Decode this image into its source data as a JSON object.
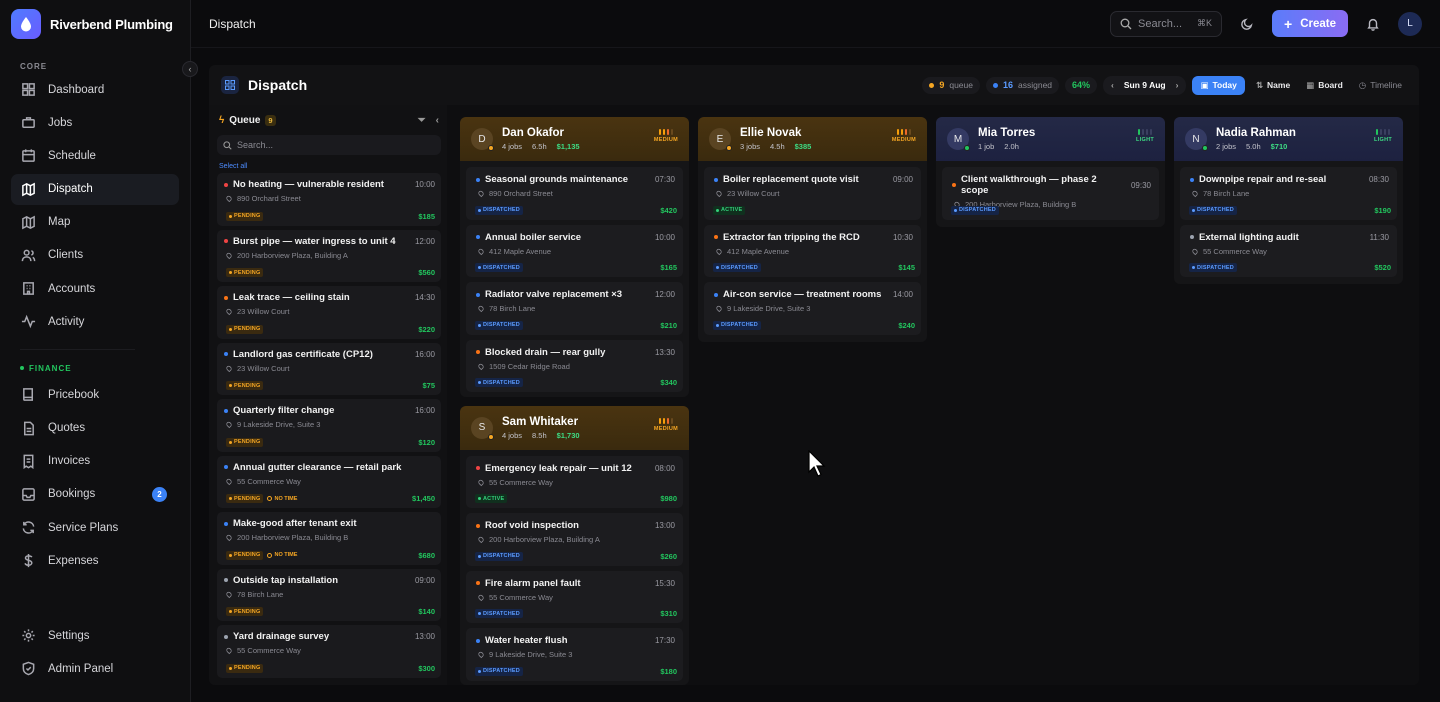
{
  "brand": {
    "name": "Riverbend Plumbing"
  },
  "sidebar": {
    "core_label": "CORE",
    "finance_label": "FINANCE",
    "core_items": [
      {
        "label": "Dashboard",
        "icon": "grid-icon"
      },
      {
        "label": "Jobs",
        "icon": "briefcase-icon"
      },
      {
        "label": "Schedule",
        "icon": "calendar-icon"
      },
      {
        "label": "Dispatch",
        "icon": "map-icon",
        "active": true
      },
      {
        "label": "Map",
        "icon": "map-icon"
      },
      {
        "label": "Clients",
        "icon": "users-icon"
      },
      {
        "label": "Accounts",
        "icon": "building-icon"
      },
      {
        "label": "Activity",
        "icon": "activity-icon"
      }
    ],
    "finance_items": [
      {
        "label": "Pricebook",
        "icon": "book-icon"
      },
      {
        "label": "Quotes",
        "icon": "document-icon"
      },
      {
        "label": "Invoices",
        "icon": "receipt-icon"
      },
      {
        "label": "Bookings",
        "icon": "inbox-icon",
        "badge": "2"
      },
      {
        "label": "Service Plans",
        "icon": "refresh-icon"
      },
      {
        "label": "Expenses",
        "icon": "dollar-icon"
      }
    ],
    "bottom_items": [
      {
        "label": "Settings",
        "icon": "gear-icon"
      },
      {
        "label": "Admin Panel",
        "icon": "shield-icon"
      }
    ]
  },
  "topbar": {
    "title": "Dispatch",
    "search_label": "Search...",
    "shortcut": "⌘K",
    "create_label": "Create",
    "user_initial": "L"
  },
  "dispatch": {
    "title": "Dispatch",
    "queue_count": "9",
    "queue_label": "queue",
    "assigned_count": "16",
    "assigned_label": "assigned",
    "utilization": "64%",
    "date": "Sun 9 Aug",
    "today_label": "Today",
    "sort_label": "Name",
    "board_label": "Board",
    "timeline_label": "Timeline"
  },
  "queue": {
    "title": "Queue",
    "count": "9",
    "search_placeholder": "Search...",
    "select_all": "Select all",
    "jobs": [
      {
        "title": "No heating — vulnerable resident",
        "time": "10:00",
        "address": "890 Orchard Street",
        "status": "PENDING",
        "price": "$185",
        "priority": "#ef4444",
        "no_time": ""
      },
      {
        "title": "Burst pipe — water ingress to unit 4",
        "time": "12:00",
        "address": "200 Harborview Plaza, Building A",
        "status": "PENDING",
        "price": "$560",
        "priority": "#ef4444",
        "no_time": ""
      },
      {
        "title": "Leak trace — ceiling stain",
        "time": "14:30",
        "address": "23 Willow Court",
        "status": "PENDING",
        "price": "$220",
        "priority": "#f97316",
        "no_time": ""
      },
      {
        "title": "Landlord gas certificate (CP12)",
        "time": "16:00",
        "address": "23 Willow Court",
        "status": "PENDING",
        "price": "$75",
        "priority": "#3b82f6",
        "no_time": ""
      },
      {
        "title": "Quarterly filter change",
        "time": "16:00",
        "address": "9 Lakeside Drive, Suite 3",
        "status": "PENDING",
        "price": "$120",
        "priority": "#3b82f6",
        "no_time": ""
      },
      {
        "title": "Annual gutter clearance — retail park",
        "time": "",
        "address": "55 Commerce Way",
        "status": "PENDING",
        "price": "$1,450",
        "priority": "#3b82f6",
        "no_time": "NO TIME"
      },
      {
        "title": "Make-good after tenant exit",
        "time": "",
        "address": "200 Harborview Plaza, Building B",
        "status": "PENDING",
        "price": "$680",
        "priority": "#3b82f6",
        "no_time": "NO TIME"
      },
      {
        "title": "Outside tap installation",
        "time": "09:00",
        "address": "78 Birch Lane",
        "status": "PENDING",
        "price": "$140",
        "priority": "#9ca3af",
        "no_time": ""
      },
      {
        "title": "Yard drainage survey",
        "time": "13:00",
        "address": "55 Commerce Way",
        "status": "PENDING",
        "price": "$300",
        "priority": "#9ca3af",
        "no_time": ""
      }
    ]
  },
  "technicians": [
    {
      "name": "Dan Okafor",
      "initial": "D",
      "jobs": "4 jobs",
      "hours": "6.5h",
      "revenue": "$1,135",
      "load": "MEDIUM",
      "status_color": "#f5a623",
      "jobs_list": [
        {
          "title": "Seasonal grounds maintenance",
          "time": "07:30",
          "address": "890 Orchard Street",
          "status": "DISPATCHED",
          "price": "$420",
          "priority": "#3b82f6"
        },
        {
          "title": "Annual boiler service",
          "time": "10:00",
          "address": "412 Maple Avenue",
          "status": "DISPATCHED",
          "price": "$165",
          "priority": "#3b82f6"
        },
        {
          "title": "Radiator valve replacement ×3",
          "time": "12:00",
          "address": "78 Birch Lane",
          "status": "DISPATCHED",
          "price": "$210",
          "priority": "#3b82f6"
        },
        {
          "title": "Blocked drain — rear gully",
          "time": "13:30",
          "address": "1509 Cedar Ridge Road",
          "status": "DISPATCHED",
          "price": "$340",
          "priority": "#f97316"
        }
      ]
    },
    {
      "name": "Ellie Novak",
      "initial": "E",
      "jobs": "3 jobs",
      "hours": "4.5h",
      "revenue": "$385",
      "load": "MEDIUM",
      "status_color": "#f5a623",
      "jobs_list": [
        {
          "title": "Boiler replacement quote visit",
          "time": "09:00",
          "address": "23 Willow Court",
          "status": "ACTIVE",
          "price": "",
          "priority": "#3b82f6"
        },
        {
          "title": "Extractor fan tripping the RCD",
          "time": "10:30",
          "address": "412 Maple Avenue",
          "status": "DISPATCHED",
          "price": "$145",
          "priority": "#f97316"
        },
        {
          "title": "Air-con service — treatment rooms",
          "time": "14:00",
          "address": "9 Lakeside Drive, Suite 3",
          "status": "DISPATCHED",
          "price": "$240",
          "priority": "#3b82f6"
        }
      ]
    },
    {
      "name": "Mia Torres",
      "initial": "M",
      "jobs": "1 job",
      "hours": "2.0h",
      "revenue": "",
      "load": "LIGHT",
      "status_color": "#22c55e",
      "jobs_list": [
        {
          "title": "Client walkthrough — phase 2 scope",
          "time": "09:30",
          "address": "200 Harborview Plaza, Building B",
          "status": "DISPATCHED",
          "price": "",
          "priority": "#f97316"
        }
      ]
    },
    {
      "name": "Nadia Rahman",
      "initial": "N",
      "jobs": "2 jobs",
      "hours": "5.0h",
      "revenue": "$710",
      "load": "LIGHT",
      "status_color": "#22c55e",
      "jobs_list": [
        {
          "title": "Downpipe repair and re-seal",
          "time": "08:30",
          "address": "78 Birch Lane",
          "status": "DISPATCHED",
          "price": "$190",
          "priority": "#3b82f6"
        },
        {
          "title": "External lighting audit",
          "time": "11:30",
          "address": "55 Commerce Way",
          "status": "DISPATCHED",
          "price": "$520",
          "priority": "#9ca3af"
        }
      ]
    },
    {
      "name": "Sam Whitaker",
      "initial": "S",
      "jobs": "4 jobs",
      "hours": "8.5h",
      "revenue": "$1,730",
      "load": "MEDIUM",
      "status_color": "#f5a623",
      "jobs_list": [
        {
          "title": "Emergency leak repair — unit 12",
          "time": "08:00",
          "address": "55 Commerce Way",
          "status": "ACTIVE",
          "price": "$980",
          "priority": "#ef4444"
        },
        {
          "title": "Roof void inspection",
          "time": "13:00",
          "address": "200 Harborview Plaza, Building A",
          "status": "DISPATCHED",
          "price": "$260",
          "priority": "#f97316"
        },
        {
          "title": "Fire alarm panel fault",
          "time": "15:30",
          "address": "55 Commerce Way",
          "status": "DISPATCHED",
          "price": "$310",
          "priority": "#f97316"
        },
        {
          "title": "Water heater flush",
          "time": "17:30",
          "address": "9 Lakeside Drive, Suite 3",
          "status": "DISPATCHED",
          "price": "$180",
          "priority": "#3b82f6"
        }
      ]
    }
  ],
  "colors": {
    "accent": "#3b82f6",
    "success": "#22c55e",
    "warning": "#f5a623",
    "danger": "#ef4444"
  }
}
